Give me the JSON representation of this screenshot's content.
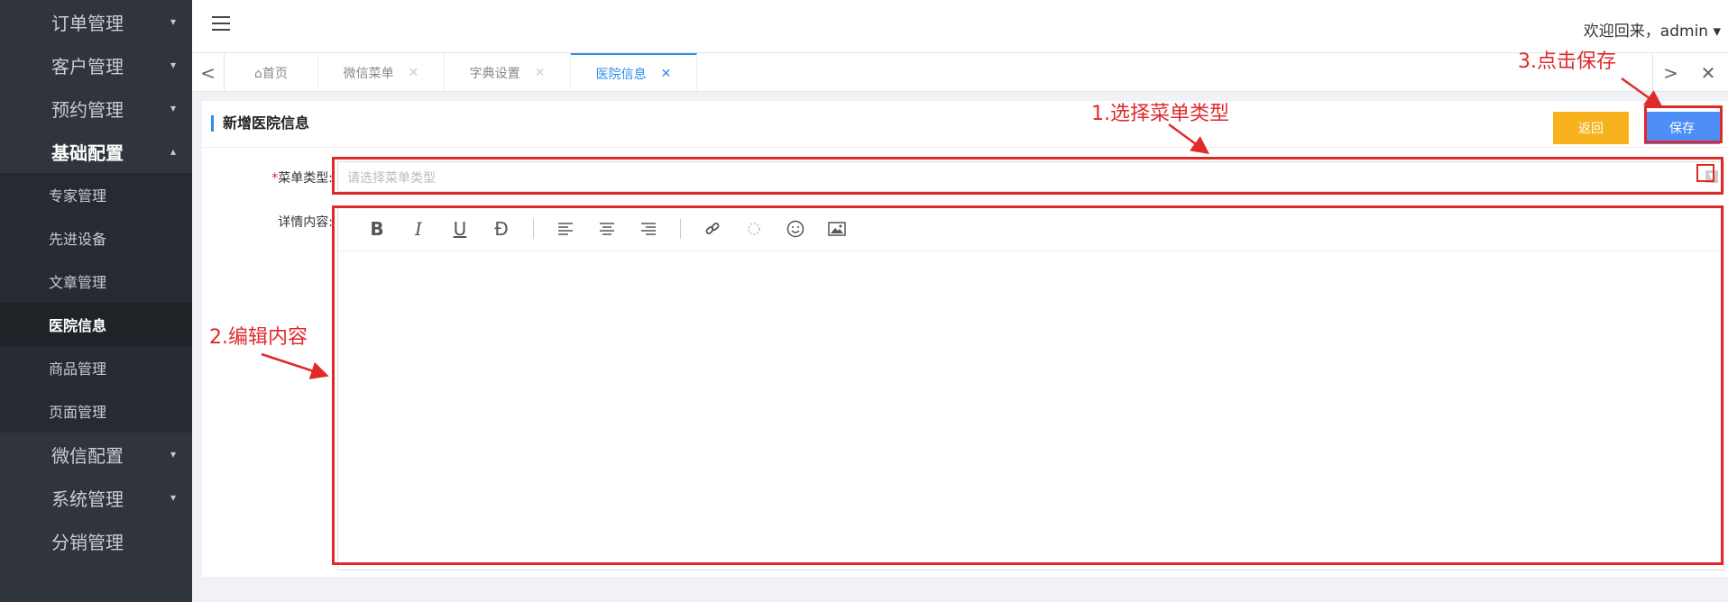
{
  "sidebar": {
    "items": [
      {
        "label": "订单管理",
        "caret": "▾"
      },
      {
        "label": "客户管理",
        "caret": "▾"
      },
      {
        "label": "预约管理",
        "caret": "▾"
      },
      {
        "label": "基础配置",
        "caret": "▴"
      }
    ],
    "sub_items": [
      "专家管理",
      "先进设备",
      "文章管理",
      "医院信息",
      "商品管理",
      "页面管理"
    ],
    "bottom_items": [
      {
        "label": "微信配置",
        "caret": "▾"
      },
      {
        "label": "系统管理",
        "caret": "▾"
      },
      {
        "label": "分销管理",
        "caret": ""
      }
    ]
  },
  "header": {
    "welcome": "欢迎回来，admin ▾"
  },
  "tabs": {
    "left_arrow": "<",
    "right_arrow": ">",
    "close_all": "✕",
    "items": [
      {
        "label": "⌂首页",
        "close": ""
      },
      {
        "label": "微信菜单",
        "close": "✕"
      },
      {
        "label": "字典设置",
        "close": "✕"
      },
      {
        "label": "医院信息",
        "close": "✕"
      }
    ]
  },
  "panel": {
    "title": "新增医院信息",
    "back_label": "返回",
    "save_label": "保存"
  },
  "form": {
    "type_required": "*",
    "type_label": "菜单类型:",
    "type_placeholder": "请选择菜单类型",
    "content_label": "详情内容:"
  },
  "toolbar": {
    "bold": "B",
    "italic": "I",
    "underline": "U",
    "strike": "Ð"
  },
  "annotations": {
    "step1": "1.选择菜单类型",
    "step2": "2.编辑内容",
    "step3": "3.点击保存",
    "color": "#e02a2a"
  }
}
